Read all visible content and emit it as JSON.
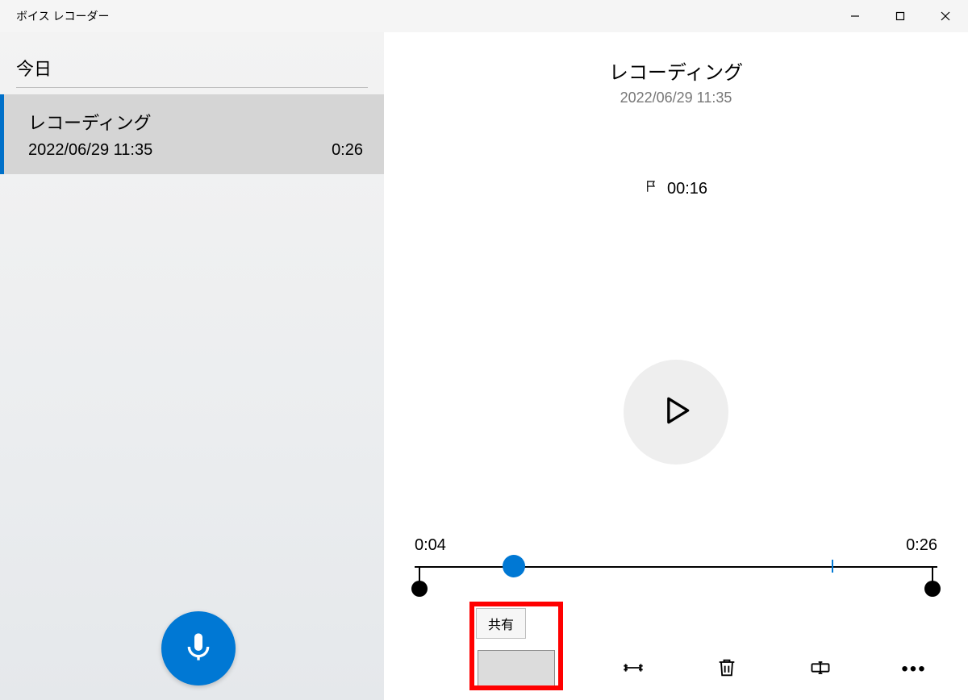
{
  "app": {
    "title": "ボイス レコーダー"
  },
  "sidebar": {
    "section_label": "今日",
    "items": [
      {
        "title": "レコーディング",
        "date": "2022/06/29 11:35",
        "duration": "0:26"
      }
    ]
  },
  "detail": {
    "title": "レコーディング",
    "date": "2022/06/29 11:35",
    "marker_time": "00:16"
  },
  "timeline": {
    "start_label": "0:04",
    "end_label": "0:26",
    "thumb_percent": 19,
    "marker_percent": 80
  },
  "toolbar": {
    "share_tooltip": "共有",
    "icons": {
      "share": "share-icon",
      "trim": "trim-icon",
      "delete": "trash-icon",
      "rename": "rename-icon",
      "more": "more-icon"
    }
  }
}
